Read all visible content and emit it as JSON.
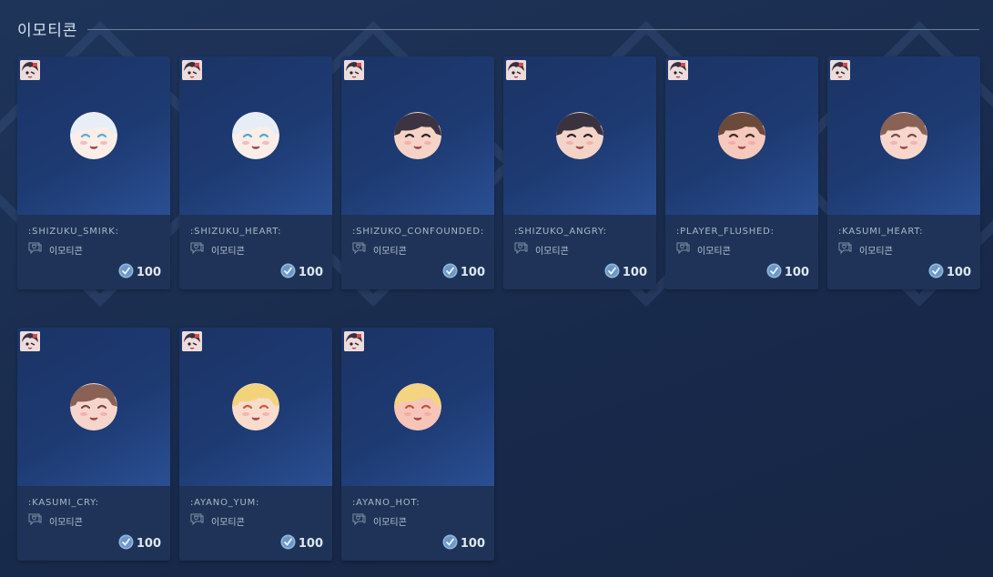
{
  "header": {
    "title": "이모티콘"
  },
  "items": [
    {
      "name": ":SHIZUKU_SMIRK:",
      "type": "이모티콘",
      "price": "100",
      "hair": "#e8eef6",
      "skin": "#fbeee8",
      "eye": "#5aa9d6"
    },
    {
      "name": ":SHIZUKU_HEART:",
      "type": "이모티콘",
      "price": "100",
      "hair": "#e6edf5",
      "skin": "#fbeee8",
      "eye": "#4ea6d6"
    },
    {
      "name": ":SHIZUKO_CONFOUNDED:",
      "type": "이모티콘",
      "price": "100",
      "hair": "#3d3442",
      "skin": "#f6d3c6",
      "eye": "#2a2228"
    },
    {
      "name": ":SHIZUKO_ANGRY:",
      "type": "이모티콘",
      "price": "100",
      "hair": "#3b3240",
      "skin": "#f4d4c8",
      "eye": "#2a2228"
    },
    {
      "name": ":PLAYER_FLUSHED:",
      "type": "이모티콘",
      "price": "100",
      "hair": "#6b4a3a",
      "skin": "#f6c9bd",
      "eye": "#3a2a22"
    },
    {
      "name": ":KASUMI_HEART:",
      "type": "이모티콘",
      "price": "100",
      "hair": "#8a6255",
      "skin": "#f7d7cd",
      "eye": "#7a4a44"
    },
    {
      "name": ":KASUMI_CRY:",
      "type": "이모티콘",
      "price": "100",
      "hair": "#8a6155",
      "skin": "#f6d6cc",
      "eye": "#7a4a44"
    },
    {
      "name": ":AYANO_YUM:",
      "type": "이모티콘",
      "price": "100",
      "hair": "#f3d37a",
      "skin": "#f9dccc",
      "eye": "#c75a3c"
    },
    {
      "name": ":AYANO_HOT:",
      "type": "이모티콘",
      "price": "100",
      "hair": "#f4d47e",
      "skin": "#f6c5b8",
      "eye": "#c2503a"
    }
  ]
}
